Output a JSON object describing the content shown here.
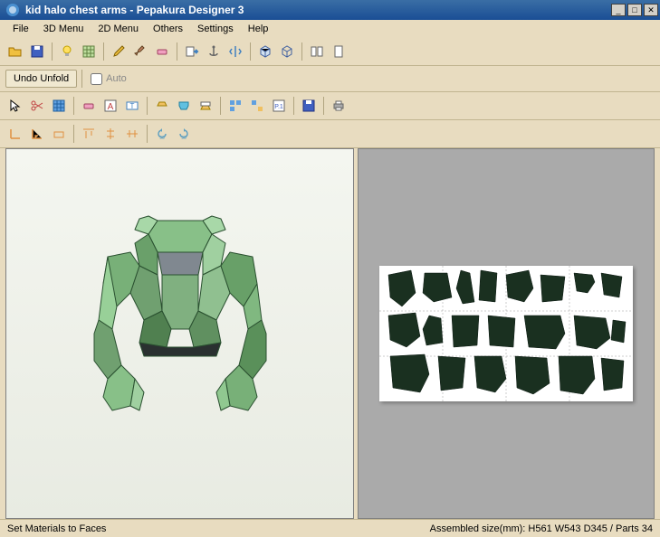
{
  "title": "kid halo chest arms - Pepakura Designer 3",
  "menu": {
    "file": "File",
    "menu3d": "3D Menu",
    "menu2d": "2D Menu",
    "others": "Others",
    "settings": "Settings",
    "help": "Help"
  },
  "unfold": {
    "undo_label": "Undo Unfold",
    "auto_label": "Auto"
  },
  "status": {
    "left": "Set Materials to Faces",
    "right": "Assembled size(mm): H561 W543 D345 / Parts 34"
  },
  "icons": {
    "open": "open-icon",
    "save": "save-icon"
  }
}
